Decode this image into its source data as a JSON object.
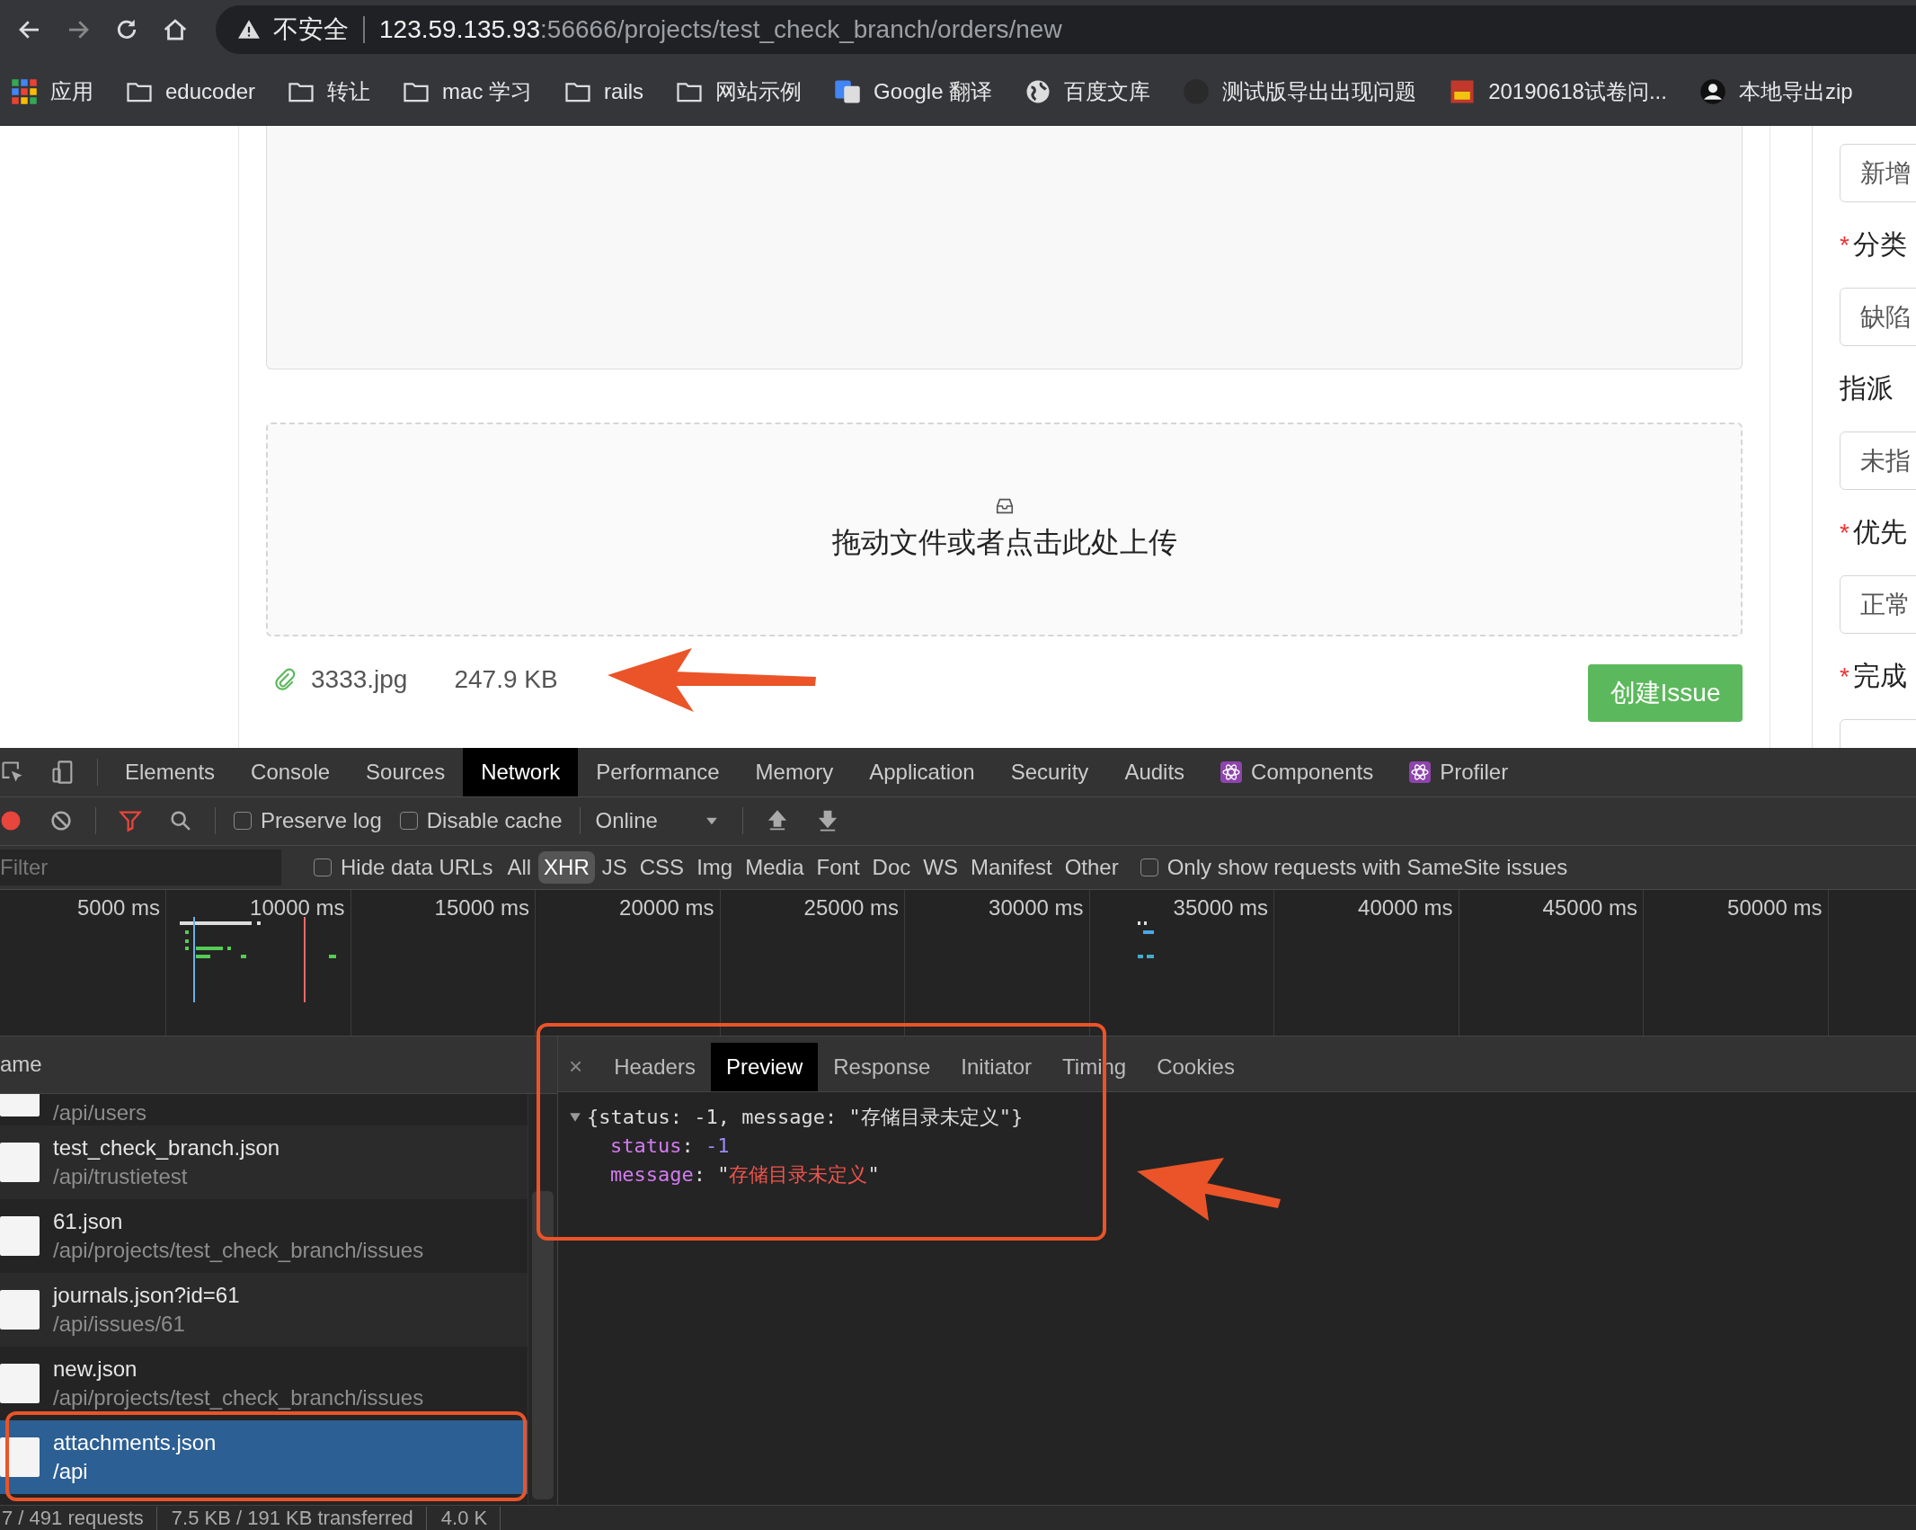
{
  "address_bar": {
    "security": "不安全",
    "host": "123.59.135.93",
    "path": ":56666/projects/test_check_branch/orders/new"
  },
  "bookmarks": [
    {
      "kind": "apps",
      "label": "应用"
    },
    {
      "kind": "folder",
      "label": "educoder"
    },
    {
      "kind": "folder",
      "label": "转让"
    },
    {
      "kind": "folder",
      "label": "mac 学习"
    },
    {
      "kind": "folder",
      "label": "rails"
    },
    {
      "kind": "folder",
      "label": "网站示例"
    },
    {
      "kind": "translate",
      "label": "Google 翻译"
    },
    {
      "kind": "globe",
      "label": "百度文库"
    },
    {
      "kind": "github",
      "label": "测试版导出出现问题"
    },
    {
      "kind": "image",
      "label": "20190618试卷问..."
    },
    {
      "kind": "avatar",
      "label": "本地导出zip"
    }
  ],
  "page": {
    "upload_hint": "拖动文件或者点击此处上传",
    "attachment": {
      "name": "3333.jpg",
      "size": "247.9 KB"
    },
    "submit_button": "创建Issue",
    "side_fields": [
      {
        "kind": "select",
        "text": "新增"
      },
      {
        "kind": "label",
        "mark": "*",
        "text": "分类"
      },
      {
        "kind": "select",
        "text": "缺陷"
      },
      {
        "kind": "label",
        "text": "指派"
      },
      {
        "kind": "select",
        "text": "未指"
      },
      {
        "kind": "label",
        "mark": "*",
        "text": "优先"
      },
      {
        "kind": "select",
        "text": "正常"
      },
      {
        "kind": "label",
        "mark": "*",
        "text": "完成"
      },
      {
        "kind": "stub"
      }
    ]
  },
  "devtools": {
    "tabs": [
      {
        "label": "Elements",
        "selected": false
      },
      {
        "label": "Console",
        "selected": false
      },
      {
        "label": "Sources",
        "selected": false
      },
      {
        "label": "Network",
        "selected": true
      },
      {
        "label": "Performance",
        "selected": false
      },
      {
        "label": "Memory",
        "selected": false
      },
      {
        "label": "Application",
        "selected": false
      },
      {
        "label": "Security",
        "selected": false
      },
      {
        "label": "Audits",
        "selected": false
      },
      {
        "label": "Components",
        "selected": false,
        "kind": "react"
      },
      {
        "label": "Profiler",
        "selected": false,
        "kind": "react"
      }
    ],
    "toolbar": {
      "recording": true,
      "filter_active": true,
      "checkboxes": [
        {
          "label": "Preserve log",
          "checked": false
        },
        {
          "label": "Disable cache",
          "checked": false
        }
      ],
      "throttle": "Online"
    },
    "filter_bar": {
      "placeholder": "Filter",
      "hide_data_urls": {
        "label": "Hide data URLs",
        "checked": false
      },
      "types": [
        {
          "label": "All",
          "selected": false
        },
        {
          "label": "XHR",
          "selected": true
        },
        {
          "label": "JS",
          "selected": false
        },
        {
          "label": "CSS",
          "selected": false
        },
        {
          "label": "Img",
          "selected": false
        },
        {
          "label": "Media",
          "selected": false
        },
        {
          "label": "Font",
          "selected": false
        },
        {
          "label": "Doc",
          "selected": false
        },
        {
          "label": "WS",
          "selected": false
        },
        {
          "label": "Manifest",
          "selected": false
        },
        {
          "label": "Other",
          "selected": false
        }
      ],
      "samesite": {
        "label": "Only show requests with SameSite issues",
        "checked": false
      }
    },
    "timeline": {
      "ticks": [
        "5000 ms",
        "10000 ms",
        "15000 ms",
        "20000 ms",
        "25000 ms",
        "30000 ms",
        "35000 ms",
        "40000 ms",
        "45000 ms",
        "50000 ms"
      ]
    },
    "requests": {
      "header": "ame",
      "rows": [
        {
          "path": "/api/users",
          "selected": false
        },
        {
          "name": "test_check_branch.json",
          "path": "/api/trustietest",
          "selected": false
        },
        {
          "name": "61.json",
          "path": "/api/projects/test_check_branch/issues",
          "selected": false
        },
        {
          "name": "journals.json?id=61",
          "path": "/api/issues/61",
          "selected": false
        },
        {
          "name": "new.json",
          "path": "/api/projects/test_check_branch/issues",
          "selected": false
        },
        {
          "name": "attachments.json",
          "path": "/api",
          "selected": true
        }
      ]
    },
    "status_bar": [
      "7 / 491 requests",
      "7.5 KB / 191 KB transferred",
      "4.0 K"
    ],
    "detail": {
      "close": "×",
      "tabs": [
        {
          "label": "Headers",
          "selected": false
        },
        {
          "label": "Preview",
          "selected": true
        },
        {
          "label": "Response",
          "selected": false
        },
        {
          "label": "Initiator",
          "selected": false
        },
        {
          "label": "Timing",
          "selected": false
        },
        {
          "label": "Cookies",
          "selected": false
        }
      ],
      "preview": {
        "expanded": true,
        "summary": "{status: -1, message: \"存储目录未定义\"}",
        "props": [
          {
            "key": "status",
            "sep": ": ",
            "value": "-1",
            "kind": "number"
          },
          {
            "key": "message",
            "sep": ": ",
            "quote": "\"",
            "value": "存储目录未定义",
            "kind": "string"
          }
        ]
      }
    }
  }
}
